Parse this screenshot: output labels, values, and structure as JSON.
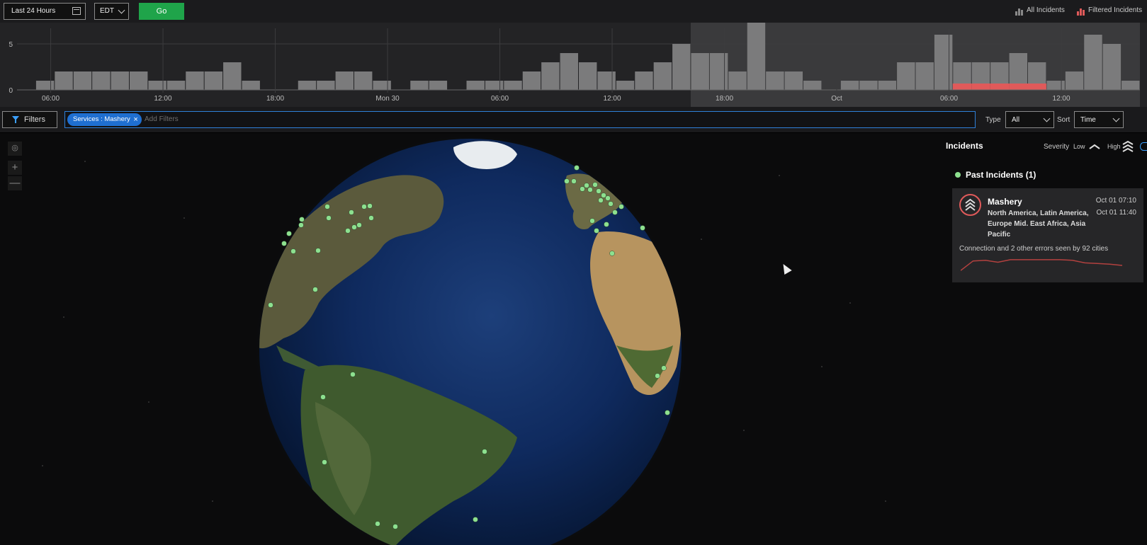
{
  "toolbar": {
    "range_label": "Last 24 Hours",
    "timezone": "EDT",
    "go_label": "Go",
    "legend_all": "All Incidents",
    "legend_filtered": "Filtered Incidents"
  },
  "colors": {
    "accent": "#1fa44a",
    "filtered": "#e05a5a",
    "chip": "#1f6fd1",
    "dot": "#8de08f"
  },
  "chart_data": {
    "type": "bar",
    "y_ticks": [
      "5",
      "0"
    ],
    "ylim": [
      0,
      8
    ],
    "x_ticks": [
      "06:00",
      "12:00",
      "18:00",
      "Mon 30",
      "06:00",
      "12:00",
      "18:00",
      "Oct",
      "06:00",
      "12:00"
    ],
    "series": [
      {
        "name": "All Incidents",
        "values": [
          0,
          1,
          2,
          2,
          2,
          2,
          2,
          1,
          1,
          2,
          2,
          3,
          1,
          0,
          0,
          1,
          1,
          2,
          2,
          1,
          0,
          1,
          1,
          0,
          1,
          1,
          1,
          2,
          3,
          4,
          3,
          2,
          1,
          2,
          3,
          5,
          4,
          4,
          2,
          8,
          2,
          2,
          1,
          0,
          1,
          1,
          1,
          3,
          3,
          6,
          3,
          3,
          3,
          4,
          3,
          1,
          2,
          6,
          5,
          1
        ]
      },
      {
        "name": "Filtered Incidents",
        "values": [
          0,
          0,
          0,
          0,
          0,
          0,
          0,
          0,
          0,
          0,
          0,
          0,
          0,
          0,
          0,
          0,
          0,
          0,
          0,
          0,
          0,
          0,
          0,
          0,
          0,
          0,
          0,
          0,
          0,
          0,
          0,
          0,
          0,
          0,
          0,
          0,
          0,
          0,
          0,
          0,
          0,
          0,
          0,
          0,
          0,
          0,
          0,
          0,
          0,
          0,
          1,
          1,
          1,
          1,
          1,
          0,
          0,
          0,
          0,
          0
        ]
      }
    ]
  },
  "filters": {
    "button_label": "Filters",
    "chip_label": "Services : Mashery",
    "chip_remove": "×",
    "placeholder": "Add Filters",
    "type_label": "Type",
    "type_value": "All",
    "sort_label": "Sort",
    "sort_value": "Time"
  },
  "map_controls": {
    "zoom_in": "+",
    "zoom_out": "—"
  },
  "panel": {
    "title": "Incidents",
    "severity_label": "Severity",
    "severity_low": "Low",
    "severity_high": "High",
    "past_heading": "Past Incidents (1)",
    "incident": {
      "name": "Mashery",
      "regions": "North America, Latin America, Europe Mid. East Africa, Asia Pacific",
      "start": "Oct 01 07:10",
      "end": "Oct 01 11:40",
      "description": "Connection and 2 other errors seen by 92 cities",
      "trend": [
        0.1,
        0.85,
        0.9,
        0.75,
        0.95,
        0.95,
        0.95,
        0.95,
        0.95,
        0.9,
        0.7,
        0.65,
        0.6,
        0.5
      ]
    }
  }
}
